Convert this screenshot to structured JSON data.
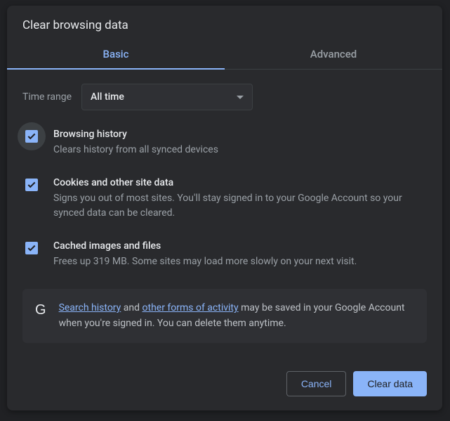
{
  "dialog": {
    "title": "Clear browsing data"
  },
  "tabs": {
    "basic": "Basic",
    "advanced": "Advanced"
  },
  "time_range": {
    "label": "Time range",
    "value": "All time"
  },
  "options": [
    {
      "title": "Browsing history",
      "desc": "Clears history from all synced devices"
    },
    {
      "title": "Cookies and other site data",
      "desc": "Signs you out of most sites. You'll stay signed in to your Google Account so your synced data can be cleared."
    },
    {
      "title": "Cached images and files",
      "desc": "Frees up 319 MB. Some sites may load more slowly on your next visit."
    }
  ],
  "info": {
    "g_label": "G",
    "link1": "Search history",
    "mid1": " and ",
    "link2": "other forms of activity",
    "tail": " may be saved in your Google Account when you're signed in. You can delete them anytime."
  },
  "buttons": {
    "cancel": "Cancel",
    "clear": "Clear data"
  }
}
